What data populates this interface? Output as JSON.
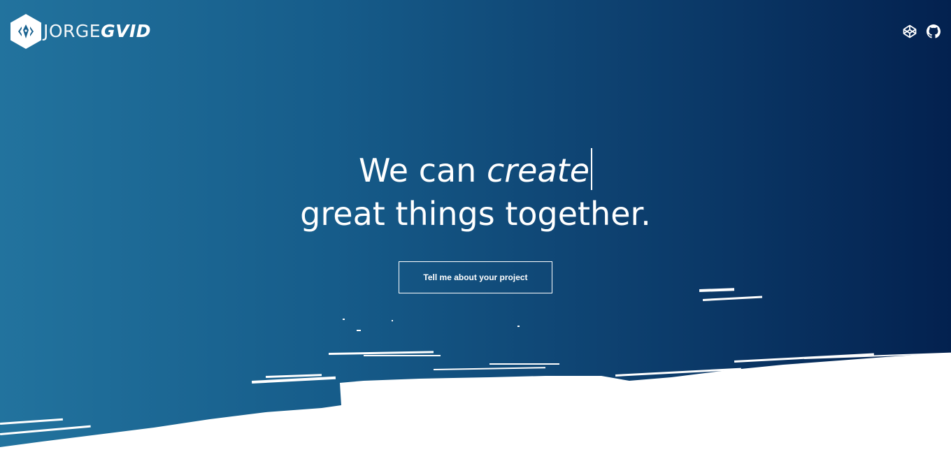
{
  "brand": {
    "name_light": "JORGE",
    "name_bold": "GVID",
    "logo_icon": "pen-nib-hexagon-icon"
  },
  "social": {
    "items": [
      {
        "icon": "codepen-icon"
      },
      {
        "icon": "github-icon"
      }
    ]
  },
  "hero": {
    "line1_prefix": "We can",
    "line1_typed": "create",
    "line2": "great things together.",
    "cta_label": "Tell me about your project"
  },
  "colors": {
    "gradient_start": "#22739e",
    "gradient_end": "#03214f",
    "text": "#ffffff",
    "page_bg": "#ffffff"
  }
}
